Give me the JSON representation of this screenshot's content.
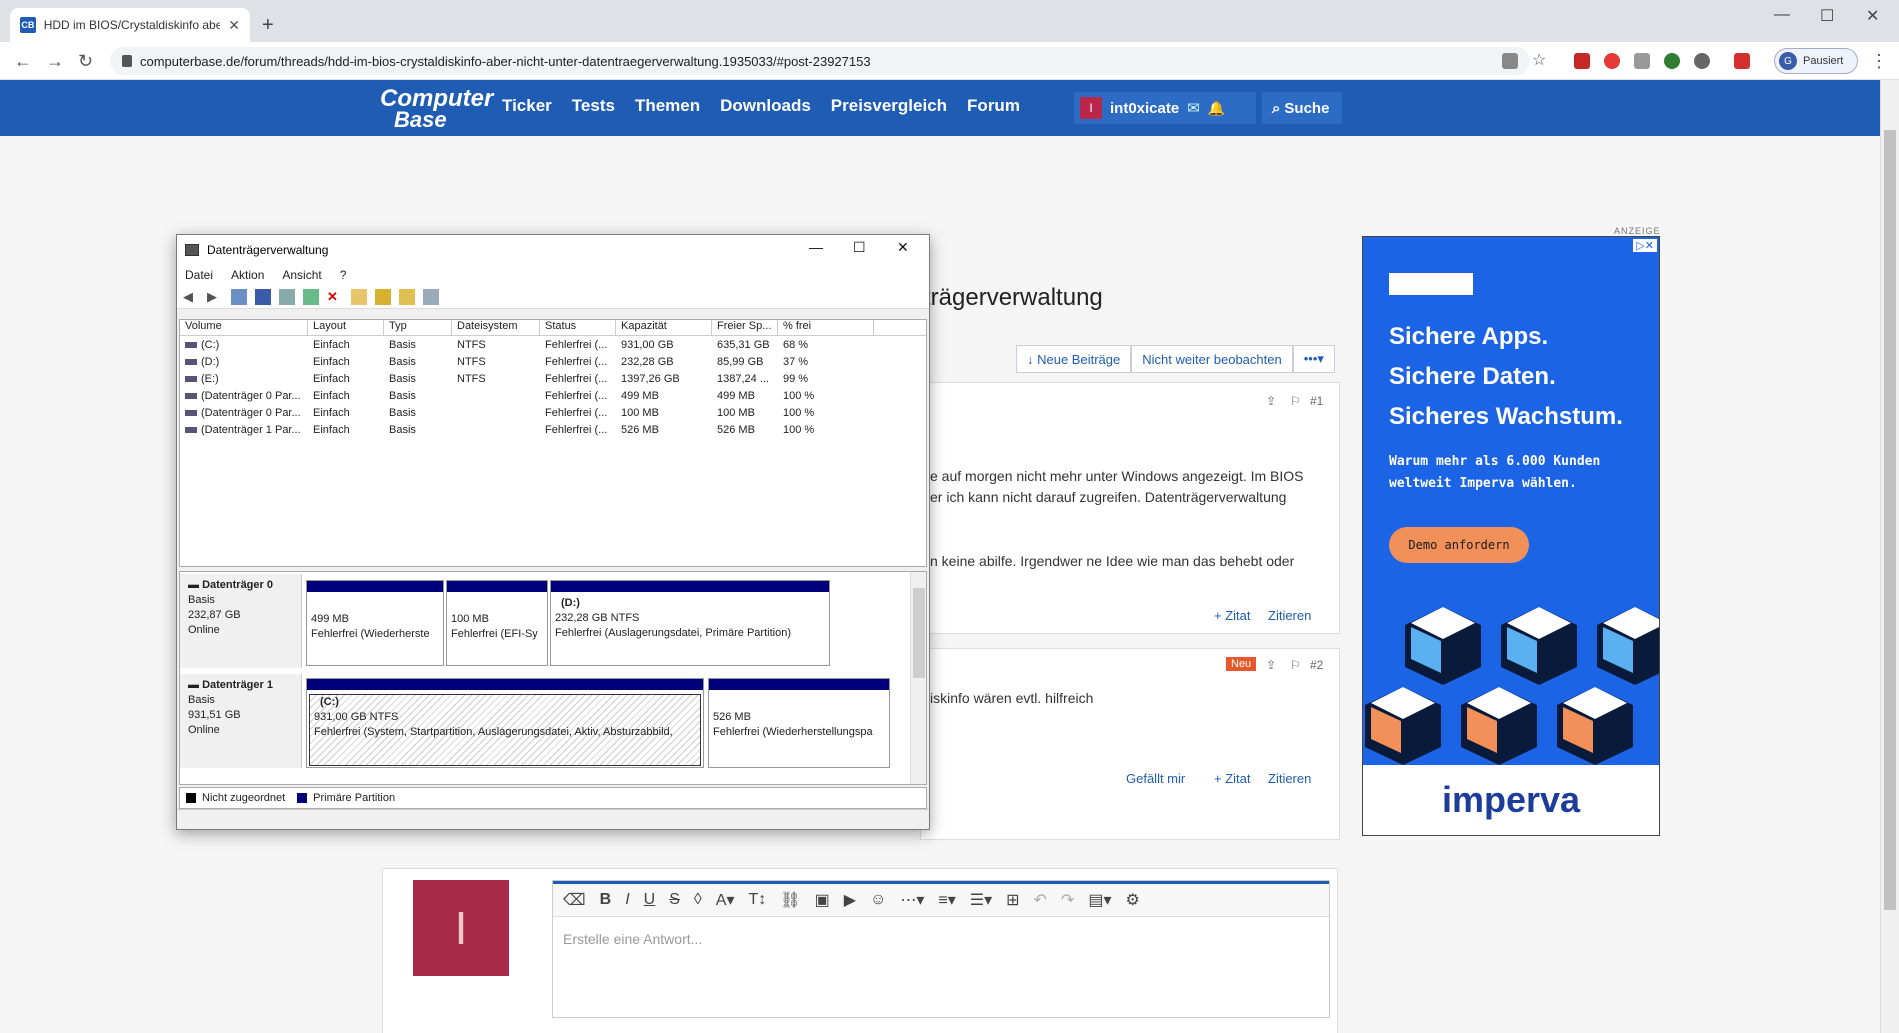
{
  "browser": {
    "tab_title": "HDD im BIOS/Crystaldiskinfo abe",
    "new_tab": "+",
    "url": "computerbase.de/forum/threads/hdd-im-bios-crystaldiskinfo-aber-nicht-unter-datentraegerverwaltung.1935033/#post-23927153",
    "profile_initial": "G",
    "profile_label": "Pausiert"
  },
  "site": {
    "logo_line1": "Computer",
    "logo_line2": "Base",
    "nav": [
      "Ticker",
      "Tests",
      "Themen",
      "Downloads",
      "Preisvergleich",
      "Forum"
    ],
    "user_initial": "I",
    "user_name": "int0xicate",
    "search_label": "Suche"
  },
  "thread": {
    "title_visible": "trägerverwaltung",
    "actions": [
      "↓ Neue Beiträge",
      "Nicht weiter beobachten",
      "•••▾"
    ],
    "post1": {
      "number": "#1",
      "line1": "e auf morgen nicht mehr unter Windows angezeigt. Im BIOS",
      "line2": "er ich kann nicht darauf zugreifen. Datenträgerverwaltung",
      "line3": "n keine abilfe. Irgendwer ne Idee wie man das behebt oder",
      "quote": "+ Zitat",
      "cite": "Zitieren"
    },
    "post2": {
      "badge": "Neu",
      "number": "#2",
      "line1": "iskinfo wären evtl. hilfreich",
      "like": "Gefällt mir",
      "quote": "+ Zitat",
      "cite": "Zitieren"
    }
  },
  "ad": {
    "label": "ANZEIGE",
    "headline": [
      "Sichere Apps.",
      "Sichere Daten.",
      "Sicheres Wachstum."
    ],
    "sub": [
      "Warum mehr als 6.000 Kunden",
      "weltweit Imperva wählen."
    ],
    "cta": "Demo anfordern",
    "brand": "imperva"
  },
  "reply": {
    "avatar_initial": "I",
    "placeholder": "Erstelle eine Antwort..."
  },
  "diskmgmt": {
    "title": "Datenträgerverwaltung",
    "menu": [
      "Datei",
      "Aktion",
      "Ansicht",
      "?"
    ],
    "columns": [
      "Volume",
      "Layout",
      "Typ",
      "Dateisystem",
      "Status",
      "Kapazität",
      "Freier Sp...",
      "% frei"
    ],
    "rows": [
      {
        "volume": "(C:)",
        "layout": "Einfach",
        "typ": "Basis",
        "fs": "NTFS",
        "status": "Fehlerfrei (...",
        "cap": "931,00 GB",
        "free": "635,31 GB",
        "pct": "68 %"
      },
      {
        "volume": "(D:)",
        "layout": "Einfach",
        "typ": "Basis",
        "fs": "NTFS",
        "status": "Fehlerfrei (...",
        "cap": "232,28 GB",
        "free": "85,99 GB",
        "pct": "37 %"
      },
      {
        "volume": "(E:)",
        "layout": "Einfach",
        "typ": "Basis",
        "fs": "NTFS",
        "status": "Fehlerfrei (...",
        "cap": "1397,26 GB",
        "free": "1387,24 ...",
        "pct": "99 %"
      },
      {
        "volume": "(Datenträger 0 Par...",
        "layout": "Einfach",
        "typ": "Basis",
        "fs": "",
        "status": "Fehlerfrei (...",
        "cap": "499 MB",
        "free": "499 MB",
        "pct": "100 %"
      },
      {
        "volume": "(Datenträger 0 Par...",
        "layout": "Einfach",
        "typ": "Basis",
        "fs": "",
        "status": "Fehlerfrei (...",
        "cap": "100 MB",
        "free": "100 MB",
        "pct": "100 %"
      },
      {
        "volume": "(Datenträger 1 Par...",
        "layout": "Einfach",
        "typ": "Basis",
        "fs": "",
        "status": "Fehlerfrei (...",
        "cap": "526 MB",
        "free": "526 MB",
        "pct": "100 %"
      }
    ],
    "disk0": {
      "name": "Datenträger 0",
      "type": "Basis",
      "size": "232,87 GB",
      "state": "Online",
      "p1_size": "499 MB",
      "p1_status": "Fehlerfrei (Wiederherste",
      "p2_size": "100 MB",
      "p2_status": "Fehlerfrei (EFI-Sy",
      "p3_label": "(D:)",
      "p3_size": "232,28 GB NTFS",
      "p3_status": "Fehlerfrei (Auslagerungsdatei, Primäre Partition)"
    },
    "disk1": {
      "name": "Datenträger 1",
      "type": "Basis",
      "size": "931,51 GB",
      "state": "Online",
      "p1_label": "(C:)",
      "p1_size": "931,00 GB NTFS",
      "p1_status": "Fehlerfrei (System, Startpartition, Auslagerungsdatei, Aktiv, Absturzabbild,",
      "p2_size": "526 MB",
      "p2_status": "Fehlerfrei (Wiederherstellungspa"
    },
    "legend": [
      "Nicht zugeordnet",
      "Primäre Partition"
    ],
    "legend_colors": [
      "#000000",
      "#00007a"
    ]
  }
}
